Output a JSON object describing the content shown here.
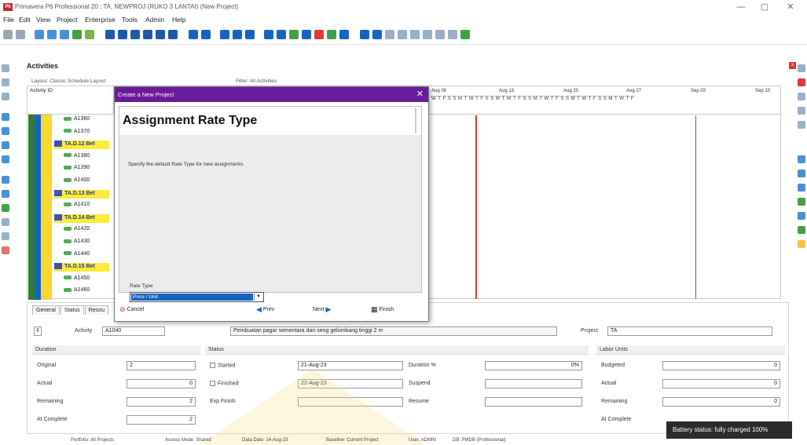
{
  "window": {
    "logo": "P6",
    "title": "Primavera P6 Professional 20 : TA, NEWPROJ (RUKO 3 LANTAI) (New Project)",
    "controls": [
      "—",
      "▢",
      "✕"
    ]
  },
  "menu": [
    "File",
    "Edit",
    "View",
    "Project",
    "Enterprise",
    "Tools",
    "Admin",
    "Help"
  ],
  "panel": {
    "title": "Activities",
    "layout_label": "Layout: Classic Schedule Layout",
    "filter_label": "Filter: All Activities",
    "column_header": "Activity ID"
  },
  "gantt": {
    "weeks": [
      "Aug 06",
      "Aug 13",
      "Aug 20",
      "Aug 27",
      "Sep 03",
      "Sep 10"
    ],
    "days": "WTFSSMTWTFSSMTWTFSSMTWTFSSMTWTFSSMTWTF"
  },
  "rows": [
    {
      "kind": "act",
      "id": "A1360"
    },
    {
      "kind": "act",
      "id": "A1370"
    },
    {
      "kind": "grp",
      "id": "TA.D.12 Bet"
    },
    {
      "kind": "act",
      "id": "A1380"
    },
    {
      "kind": "act",
      "id": "A1390"
    },
    {
      "kind": "act",
      "id": "A1400"
    },
    {
      "kind": "grp",
      "id": "TA.D.13 Bet"
    },
    {
      "kind": "act",
      "id": "A1410"
    },
    {
      "kind": "grp",
      "id": "TA.D.14 Bet"
    },
    {
      "kind": "act",
      "id": "A1420"
    },
    {
      "kind": "act",
      "id": "A1430"
    },
    {
      "kind": "act",
      "id": "A1440"
    },
    {
      "kind": "grp",
      "id": "TA.D.15 Bet"
    },
    {
      "kind": "act",
      "id": "A1450"
    },
    {
      "kind": "act",
      "id": "A1460"
    }
  ],
  "dialog": {
    "title": "Create a New Project",
    "close": "✕",
    "heading": "Assignment Rate Type",
    "description": "Specify the default Rate Type for new assignments.",
    "rate_type_label": "Rate Type",
    "rate_type_value": "Price / Unit",
    "buttons": {
      "cancel": "Cancel",
      "prev": "Prev",
      "next": "Next",
      "finish": "Finish"
    }
  },
  "details": {
    "tabs": [
      "General",
      "Status",
      "Resou"
    ],
    "activity_label": "Activity",
    "activity_id": "A1040",
    "activity_name": "Pembuatan pagar sementara dari seng gelombang tinggi 2 m",
    "project_label": "Project",
    "project_value": "TA",
    "duration": {
      "header": "Duration",
      "original_label": "Original",
      "original": "2",
      "actual_label": "Actual",
      "actual": "0",
      "remaining_label": "Remaining",
      "remaining": "2",
      "at_complete_label": "At Complete",
      "at_complete": "2"
    },
    "status": {
      "header": "Status",
      "started_label": "Started",
      "started_date": "21-Aug-23",
      "finished_label": "Finished",
      "finished_date": "22-Aug-23",
      "exp_finish_label": "Exp Finish",
      "duration_pct_label": "Duration %",
      "duration_pct": "0%",
      "suspend_label": "Suspend",
      "resume_label": "Resume"
    },
    "labor": {
      "header": "Labor Units",
      "budgeted_label": "Budgeted",
      "budgeted": "0",
      "actual_label": "Actual",
      "actual": "0",
      "remaining_label": "Remaining",
      "remaining": "0",
      "at_complete_label": "At Complete"
    }
  },
  "statusbar": {
    "portfolio": "Portfolio: All Projects",
    "access": "Access Mode: Shared",
    "data_date": "Data Date: 14-Aug-23",
    "baseline": "Baseline: Current Project",
    "user": "User: ADMIN",
    "db": "DB: PMDB (Professional)"
  },
  "toast": "Battery status: fully charged 100%",
  "colors": {
    "dialog_title": "#6a1b9a",
    "selection": "#1565c0",
    "today_line": "#e53935",
    "group_row": "#ffeb3b"
  }
}
